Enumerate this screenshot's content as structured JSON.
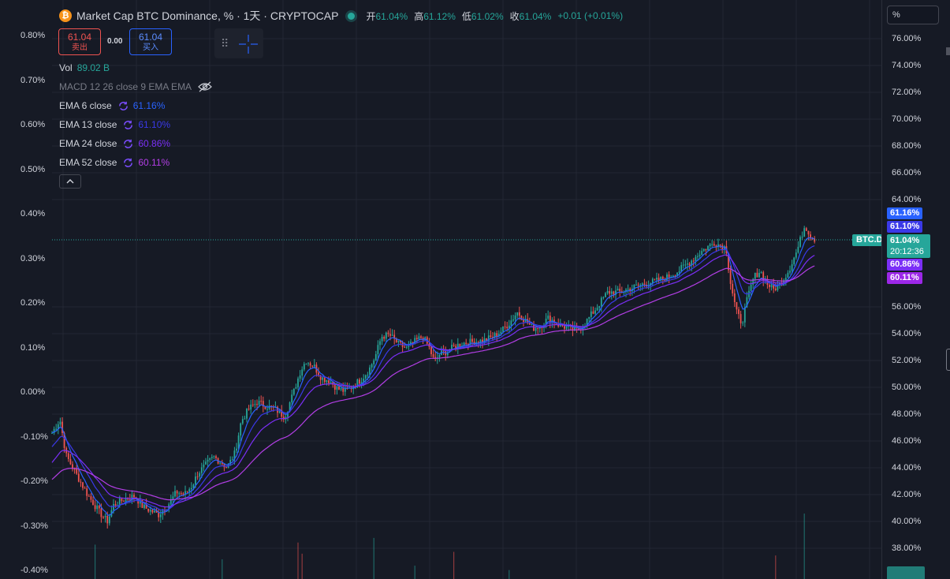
{
  "header": {
    "title": "Market Cap BTC Dominance, % · 1天 · CRYPTOCAP",
    "open_label": "开",
    "open": "61.04%",
    "high_label": "高",
    "high": "61.12%",
    "low_label": "低",
    "low": "61.02%",
    "close_label": "收",
    "close": "61.04%",
    "change": "+0.01 (+0.01%)"
  },
  "trade": {
    "sell_price": "61.04",
    "sell_label": "卖出",
    "spread": "0.00",
    "buy_price": "61.04",
    "buy_label": "买入"
  },
  "legend": {
    "vol_label": "Vol",
    "vol_value": "89.02 B",
    "macd_label": "MACD 12 26 close 9 EMA EMA",
    "ema": [
      {
        "label": "EMA 6 close",
        "value": "61.16%",
        "color": "#2962ff"
      },
      {
        "label": "EMA 13 close",
        "value": "61.10%",
        "color": "#3a39e8"
      },
      {
        "label": "EMA 24 close",
        "value": "60.86%",
        "color": "#7b2ff7"
      },
      {
        "label": "EMA 52 close",
        "value": "60.11%",
        "color": "#b33ee6"
      }
    ]
  },
  "left_axis": [
    "0.80%",
    "0.70%",
    "0.60%",
    "0.50%",
    "0.40%",
    "0.30%",
    "0.20%",
    "0.10%",
    "0.00%",
    "-0.10%",
    "-0.20%",
    "-0.30%",
    "-0.40%"
  ],
  "right_axis": {
    "unit": "%",
    "ticks": [
      "76.00%",
      "74.00%",
      "72.00%",
      "70.00%",
      "68.00%",
      "66.00%",
      "64.00%",
      "56.00%",
      "54.00%",
      "52.00%",
      "50.00%",
      "48.00%",
      "46.00%",
      "44.00%",
      "42.00%",
      "40.00%",
      "38.00%"
    ],
    "tags": {
      "ema6": "61.16%",
      "ema13": "61.10%",
      "current": "61.04%",
      "countdown": "20:12:36",
      "ema24": "60.86%",
      "ema52": "60.11%",
      "symbol": "BTC.D"
    }
  },
  "colors": {
    "up": "#26a69a",
    "down": "#ef5350",
    "bg": "#161a25"
  },
  "chart_data": {
    "type": "candlestick",
    "symbol": "BTC.D",
    "timeframe": "1天",
    "ylim": [
      37,
      77
    ],
    "close_path": [
      [
        0,
        46.6
      ],
      [
        10,
        47.6
      ],
      [
        18,
        44.9
      ],
      [
        30,
        43.6
      ],
      [
        45,
        42.0
      ],
      [
        60,
        40.7
      ],
      [
        70,
        40.0
      ],
      [
        78,
        41.2
      ],
      [
        90,
        41.6
      ],
      [
        105,
        41.9
      ],
      [
        115,
        41.1
      ],
      [
        125,
        40.8
      ],
      [
        135,
        40.5
      ],
      [
        148,
        41.3
      ],
      [
        158,
        42.2
      ],
      [
        168,
        42.0
      ],
      [
        178,
        42.7
      ],
      [
        185,
        43.6
      ],
      [
        195,
        44.2
      ],
      [
        205,
        44.8
      ],
      [
        215,
        44.4
      ],
      [
        222,
        44.0
      ],
      [
        232,
        45.1
      ],
      [
        240,
        47.5
      ],
      [
        250,
        48.4
      ],
      [
        260,
        48.9
      ],
      [
        272,
        48.6
      ],
      [
        285,
        48.3
      ],
      [
        295,
        47.8
      ],
      [
        305,
        49.4
      ],
      [
        315,
        51.2
      ],
      [
        322,
        52.0
      ],
      [
        332,
        51.6
      ],
      [
        342,
        50.7
      ],
      [
        352,
        50.5
      ],
      [
        362,
        49.9
      ],
      [
        372,
        49.7
      ],
      [
        382,
        50.1
      ],
      [
        392,
        50.6
      ],
      [
        402,
        51.3
      ],
      [
        410,
        52.3
      ],
      [
        418,
        53.8
      ],
      [
        428,
        53.9
      ],
      [
        440,
        53.2
      ],
      [
        450,
        52.9
      ],
      [
        460,
        53.4
      ],
      [
        470,
        53.8
      ],
      [
        478,
        53.0
      ],
      [
        485,
        51.9
      ],
      [
        492,
        52.5
      ],
      [
        502,
        52.7
      ],
      [
        512,
        53.1
      ],
      [
        522,
        53.3
      ],
      [
        535,
        53.4
      ],
      [
        548,
        53.5
      ],
      [
        560,
        53.8
      ],
      [
        570,
        54.2
      ],
      [
        580,
        54.8
      ],
      [
        590,
        55.6
      ],
      [
        600,
        55.0
      ],
      [
        610,
        54.4
      ],
      [
        620,
        54.6
      ],
      [
        630,
        55.2
      ],
      [
        642,
        54.7
      ],
      [
        655,
        54.4
      ],
      [
        665,
        54.2
      ],
      [
        675,
        54.7
      ],
      [
        690,
        55.9
      ],
      [
        705,
        57.1
      ],
      [
        720,
        57.1
      ],
      [
        735,
        57.4
      ],
      [
        750,
        57.7
      ],
      [
        765,
        57.9
      ],
      [
        780,
        58.2
      ],
      [
        795,
        58.7
      ],
      [
        810,
        59.4
      ],
      [
        825,
        60.2
      ],
      [
        840,
        60.8
      ],
      [
        855,
        60.4
      ],
      [
        860,
        58.0
      ],
      [
        868,
        55.6
      ],
      [
        875,
        54.8
      ],
      [
        882,
        56.6
      ],
      [
        890,
        58.2
      ],
      [
        898,
        58.7
      ],
      [
        906,
        57.8
      ],
      [
        915,
        57.3
      ],
      [
        925,
        57.8
      ],
      [
        935,
        58.8
      ],
      [
        945,
        60.2
      ],
      [
        955,
        62.1
      ],
      [
        962,
        61.3
      ],
      [
        968,
        61.04
      ]
    ]
  }
}
